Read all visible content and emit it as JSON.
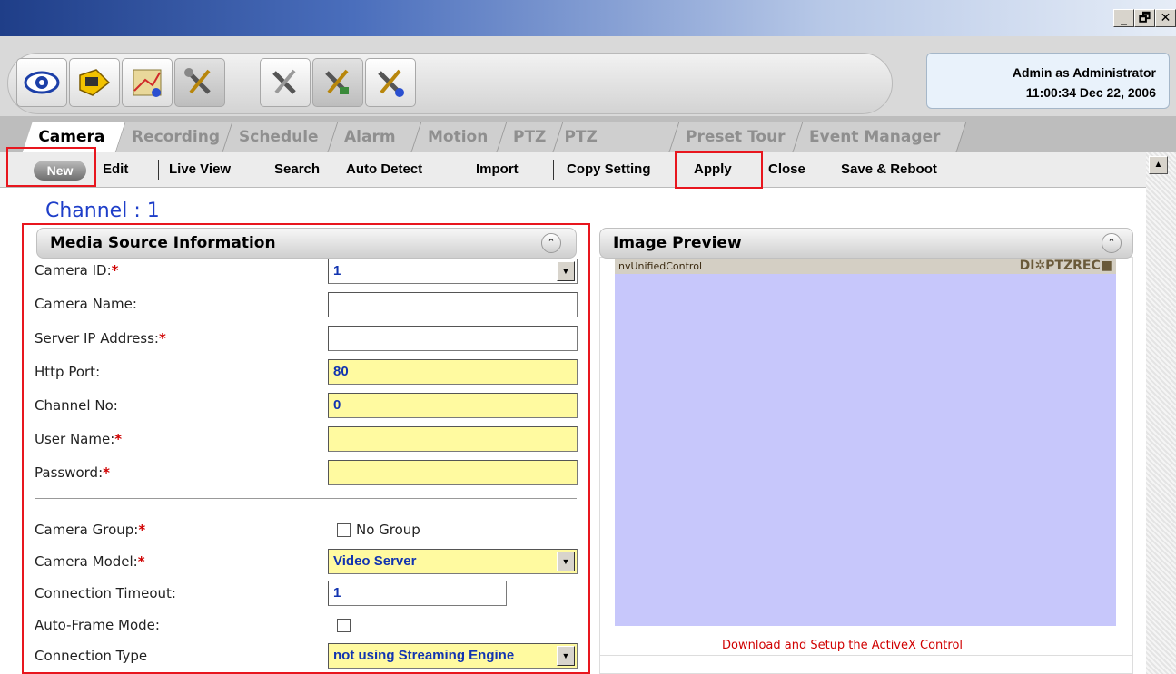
{
  "window": {
    "min_label": "_",
    "max_label": "🗗",
    "close_label": "✕"
  },
  "toolbar": {
    "icons": [
      "live-view-icon",
      "playback-icon",
      "emap-icon",
      "setup-tools-icon",
      "camera-tools-icon",
      "setup-tools-active-icon",
      "config-tools-icon"
    ]
  },
  "user": {
    "line1": "Admin as Administrator",
    "line2": "11:00:34 Dec 22, 2006"
  },
  "tabs": [
    "Camera",
    "Recording",
    "Schedule",
    "Alarm",
    "Motion",
    "PTZ",
    "PTZ Preset",
    "Preset Tour",
    "Event Manager"
  ],
  "actions": {
    "new": "New",
    "edit": "Edit",
    "live_view": "Live View",
    "search": "Search",
    "auto_detect": "Auto Detect",
    "import": "Import",
    "copy_setting": "Copy Setting",
    "apply": "Apply",
    "close": "Close",
    "save_reboot": "Save & Reboot"
  },
  "channel": "Channel : 1",
  "media_panel": {
    "title": "Media Source Information",
    "fields": {
      "camera_id": {
        "label": "Camera ID:",
        "value": "1"
      },
      "camera_name": {
        "label": "Camera Name:",
        "value": ""
      },
      "server_ip": {
        "label": "Server IP Address:",
        "value": ""
      },
      "http_port": {
        "label": "Http Port:",
        "value": "80"
      },
      "channel_no": {
        "label": "Channel No:",
        "value": "0"
      },
      "user_name": {
        "label": "User Name:",
        "value": ""
      },
      "password": {
        "label": "Password:",
        "value": ""
      },
      "camera_group": {
        "label": "Camera Group:",
        "checkbox_label": "No Group"
      },
      "camera_model": {
        "label": "Camera Model:",
        "value": "Video Server"
      },
      "connection_timeout": {
        "label": "Connection Timeout:",
        "value": "1"
      },
      "auto_frame": {
        "label": "Auto-Frame Mode:"
      },
      "connection_type": {
        "label": "Connection Type",
        "value": "not using Streaming Engine"
      }
    },
    "required_mark": "*"
  },
  "preview_panel": {
    "title": "Image Preview",
    "control_name": "nvUnifiedControl",
    "status_indicators": "DI✲PTZREC■",
    "download_link": "Download and Setup the ActiveX Control"
  },
  "colors": {
    "required": "#d00000",
    "highlight_box": "#e8161e",
    "field_value": "#1234b0",
    "preview_bg": "#c7c7fb"
  }
}
